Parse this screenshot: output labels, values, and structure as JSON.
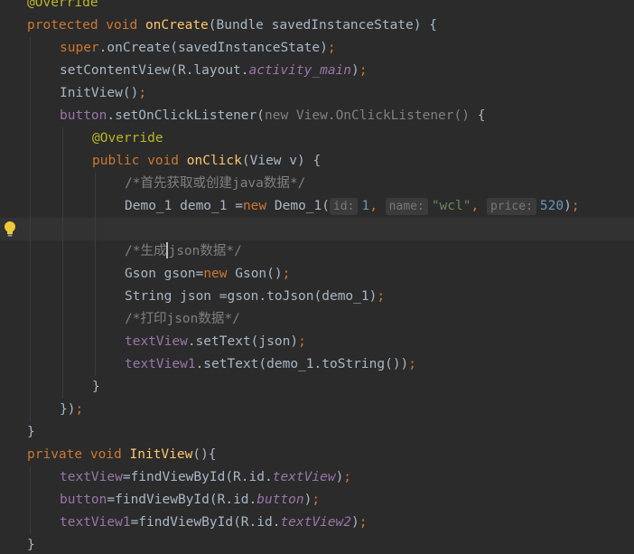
{
  "editor": {
    "lines": [
      {
        "indent": 0,
        "tokens": [
          [
            "ann",
            "@Override"
          ]
        ]
      },
      {
        "indent": 0,
        "tokens": [
          [
            "kw",
            "protected void "
          ],
          [
            "fn",
            "onCreate"
          ],
          [
            "pl",
            "(Bundle savedInstanceState) {"
          ]
        ]
      },
      {
        "indent": 1,
        "tokens": [
          [
            "kw",
            "super"
          ],
          [
            "pl",
            ".onCreate(savedInstanceState)"
          ],
          [
            "kw",
            ";"
          ]
        ]
      },
      {
        "indent": 1,
        "tokens": [
          [
            "pl",
            "setContentView(R.layout."
          ],
          [
            "ifld",
            "activity_main"
          ],
          [
            "pl",
            ")"
          ],
          [
            "kw",
            ";"
          ]
        ]
      },
      {
        "indent": 1,
        "tokens": [
          [
            "pl",
            "InitView()"
          ],
          [
            "kw",
            ";"
          ]
        ]
      },
      {
        "indent": 1,
        "tokens": [
          [
            "fld",
            "button"
          ],
          [
            "pl",
            ".setOnClickListener("
          ],
          [
            "gr",
            "new View.OnClickListener() "
          ],
          [
            "pl",
            "{"
          ]
        ]
      },
      {
        "indent": 2,
        "tokens": [
          [
            "ann",
            "@Override"
          ]
        ]
      },
      {
        "indent": 2,
        "tokens": [
          [
            "kw",
            "public void "
          ],
          [
            "fn",
            "onClick"
          ],
          [
            "pl",
            "(View v) {"
          ]
        ]
      },
      {
        "indent": 3,
        "tokens": [
          [
            "cmt",
            "/*首先获取或创建java数据*/"
          ]
        ]
      },
      {
        "indent": 3,
        "tokens": [
          [
            "pl",
            "Demo_1 demo_1 ="
          ],
          [
            "kw",
            "new "
          ],
          [
            "pl",
            "Demo_1("
          ],
          [
            "hint",
            "id:"
          ],
          [
            "num",
            "1"
          ],
          [
            "kw",
            ", "
          ],
          [
            "hint",
            "name:"
          ],
          [
            "str",
            "\"wcl\""
          ],
          [
            "kw",
            ", "
          ],
          [
            "hint",
            "price:"
          ],
          [
            "num",
            "520"
          ],
          [
            "pl",
            ")"
          ],
          [
            "kw",
            ";"
          ]
        ]
      },
      {
        "indent": 3,
        "tokens": [],
        "current": true,
        "bulb": true
      },
      {
        "indent": 3,
        "tokens": [
          [
            "cmt",
            "/*生成"
          ],
          [
            "caret",
            ""
          ],
          [
            "cmt",
            "json数据*/"
          ]
        ]
      },
      {
        "indent": 3,
        "tokens": [
          [
            "pl",
            "Gson gson="
          ],
          [
            "kw",
            "new "
          ],
          [
            "pl",
            "Gson()"
          ],
          [
            "kw",
            ";"
          ]
        ]
      },
      {
        "indent": 3,
        "tokens": [
          [
            "pl",
            "String json =gson.toJson(demo_1)"
          ],
          [
            "kw",
            ";"
          ]
        ]
      },
      {
        "indent": 3,
        "tokens": [
          [
            "cmt",
            "/*打印json数据*/"
          ]
        ]
      },
      {
        "indent": 3,
        "tokens": [
          [
            "fld",
            "textView"
          ],
          [
            "pl",
            ".setText(json)"
          ],
          [
            "kw",
            ";"
          ]
        ]
      },
      {
        "indent": 3,
        "tokens": [
          [
            "fld",
            "textView1"
          ],
          [
            "pl",
            ".setText(demo_1.toString())"
          ],
          [
            "kw",
            ";"
          ]
        ]
      },
      {
        "indent": 2,
        "tokens": [
          [
            "pl",
            "}"
          ]
        ]
      },
      {
        "indent": 1,
        "tokens": [
          [
            "pl",
            "})"
          ],
          [
            "kw",
            ";"
          ]
        ]
      },
      {
        "indent": 0,
        "tokens": [
          [
            "pl",
            "}"
          ]
        ]
      },
      {
        "indent": 0,
        "tokens": [
          [
            "kw",
            "private void "
          ],
          [
            "fn",
            "InitView"
          ],
          [
            "pl",
            "(){"
          ]
        ]
      },
      {
        "indent": 1,
        "tokens": [
          [
            "fld",
            "textView"
          ],
          [
            "pl",
            "=findViewById(R.id."
          ],
          [
            "ifld",
            "textView"
          ],
          [
            "pl",
            ")"
          ],
          [
            "kw",
            ";"
          ]
        ]
      },
      {
        "indent": 1,
        "tokens": [
          [
            "fld",
            "button"
          ],
          [
            "pl",
            "=findViewById(R.id."
          ],
          [
            "ifld",
            "button"
          ],
          [
            "pl",
            ")"
          ],
          [
            "kw",
            ";"
          ]
        ]
      },
      {
        "indent": 1,
        "tokens": [
          [
            "fld",
            "textView1"
          ],
          [
            "pl",
            "=findViewById(R.id."
          ],
          [
            "ifld",
            "textView2"
          ],
          [
            "pl",
            ")"
          ],
          [
            "kw",
            ";"
          ]
        ]
      },
      {
        "indent": 0,
        "tokens": [
          [
            "pl",
            "}"
          ]
        ]
      }
    ],
    "icons": {
      "gutter": "lightbulb-icon"
    },
    "colors": {
      "background": "#2b2b2b",
      "current_line": "#323232",
      "keyword": "#cc7832",
      "annotation": "#bbb529",
      "method": "#ffc66d",
      "field": "#9876aa",
      "number": "#6897bb",
      "string": "#6a8759",
      "comment": "#808080",
      "text": "#a9b7c6",
      "bulb": "#f0c93b"
    }
  }
}
